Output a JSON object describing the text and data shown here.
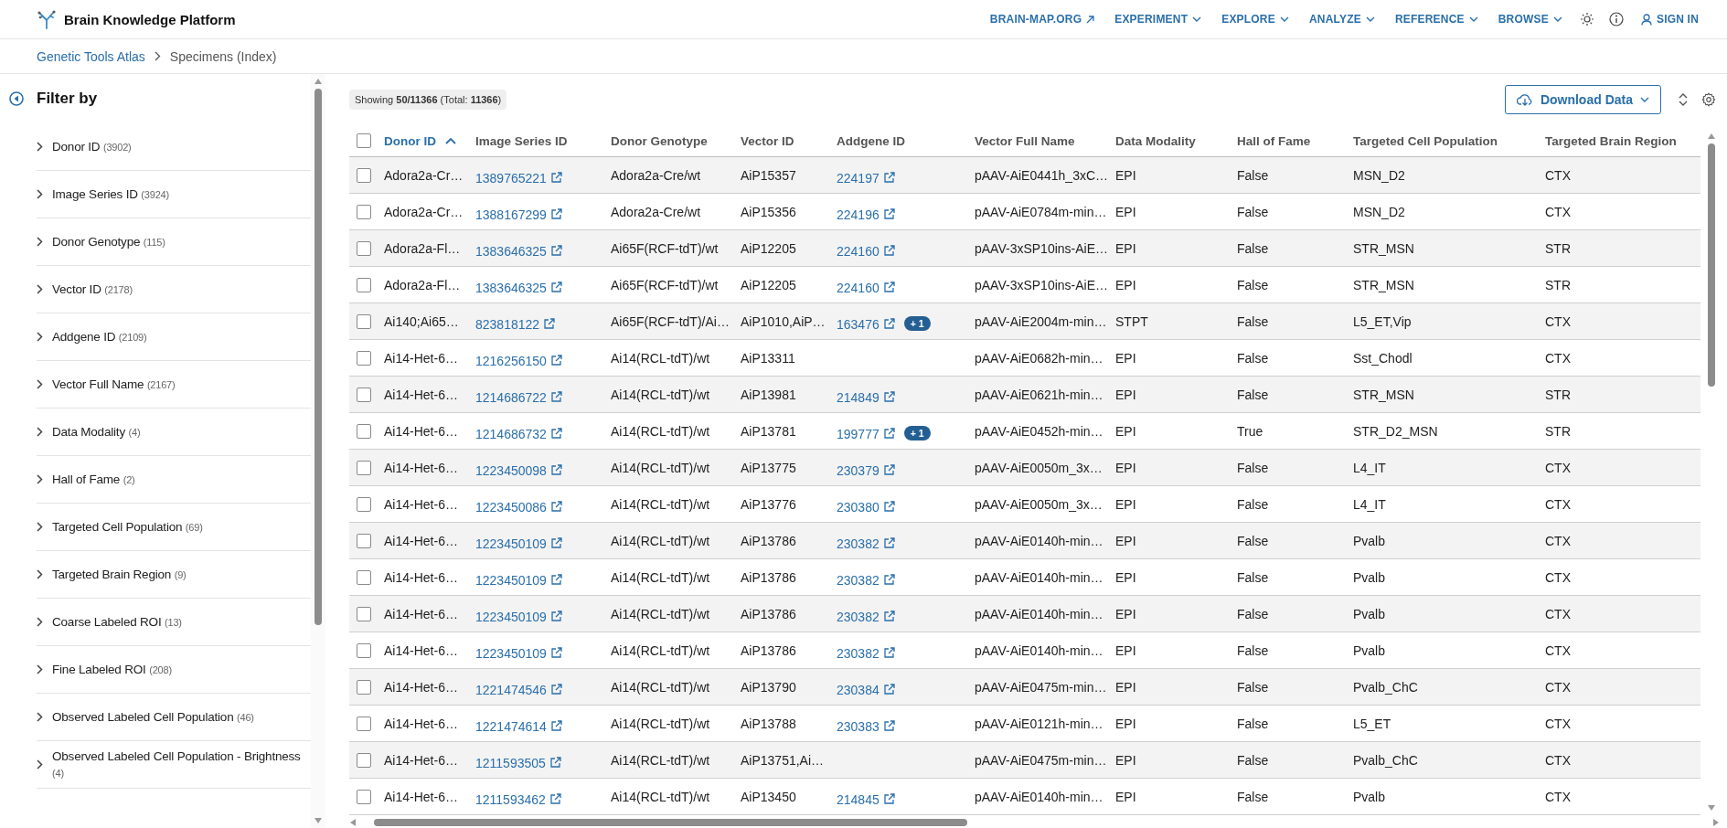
{
  "header": {
    "title": "Brain Knowledge Platform",
    "nav": [
      {
        "label": "BRAIN-MAP.ORG",
        "kind": "external"
      },
      {
        "label": "EXPERIMENT",
        "kind": "menu"
      },
      {
        "label": "EXPLORE",
        "kind": "menu"
      },
      {
        "label": "ANALYZE",
        "kind": "menu"
      },
      {
        "label": "REFERENCE",
        "kind": "menu"
      },
      {
        "label": "BROWSE",
        "kind": "menu"
      }
    ],
    "sign_in": "SIGN IN"
  },
  "breadcrumb": [
    {
      "label": "Genetic Tools Atlas",
      "kind": "link"
    },
    {
      "label": "Specimens (Index)",
      "kind": "current"
    }
  ],
  "sidebar": {
    "title": "Filter by",
    "filters": [
      {
        "label": "Donor ID",
        "count": "(3902)",
        "expanded": false
      },
      {
        "label": "Image Series ID",
        "count": "(3924)",
        "expanded": false
      },
      {
        "label": "Donor Genotype",
        "count": "(115)",
        "expanded": false
      },
      {
        "label": "Vector ID",
        "count": "(2178)",
        "expanded": false
      },
      {
        "label": "Addgene ID",
        "count": "(2109)",
        "expanded": false
      },
      {
        "label": "Vector Full Name",
        "count": "(2167)",
        "expanded": false
      },
      {
        "label": "Data Modality",
        "count": "(4)",
        "expanded": false
      },
      {
        "label": "Hall of Fame",
        "count": "(2)",
        "expanded": false
      },
      {
        "label": "Targeted Cell Population",
        "count": "(69)",
        "expanded": false
      },
      {
        "label": "Targeted Brain Region",
        "count": "(9)",
        "expanded": false
      },
      {
        "label": "Coarse Labeled ROI",
        "count": "(13)",
        "expanded": false
      },
      {
        "label": "Fine Labeled ROI",
        "count": "(208)",
        "expanded": false
      },
      {
        "label": "Observed Labeled Cell Population",
        "count": "(46)",
        "expanded": false
      },
      {
        "label": "Observed Labeled Cell Population - Brightness",
        "count": "(4)",
        "expanded": false
      }
    ]
  },
  "table": {
    "summary": "Showing **50/11366** (Total: **11366**)",
    "download_button": "Download Data",
    "all_selected": false,
    "columns": [
      {
        "label": "Donor ID",
        "kind": "text",
        "sorted": true
      },
      {
        "label": "Image Series ID",
        "kind": "link",
        "sorted": false
      },
      {
        "label": "Donor Genotype",
        "kind": "text",
        "sorted": false
      },
      {
        "label": "Vector ID",
        "kind": "text",
        "sorted": false
      },
      {
        "label": "Addgene ID",
        "kind": "link",
        "sorted": false
      },
      {
        "label": "Vector Full Name",
        "kind": "text",
        "sorted": false
      },
      {
        "label": "Data Modality",
        "kind": "text",
        "sorted": false
      },
      {
        "label": "Hall of Fame",
        "kind": "text",
        "sorted": false
      },
      {
        "label": "Targeted Cell Population",
        "kind": "text",
        "sorted": false
      },
      {
        "label": "Targeted Brain Region",
        "kind": "text",
        "sorted": false
      }
    ],
    "rows": [
      {
        "selected": false,
        "cells": [
          "Adora2a-Cr…",
          "1389765221",
          "Adora2a-Cre/wt",
          "AiP15357",
          "224197",
          "pAAV-AiE0441h_3xC…",
          "EPI",
          "False",
          "MSN_D2",
          "CTX"
        ]
      },
      {
        "selected": false,
        "cells": [
          "Adora2a-Cr…",
          "1388167299",
          "Adora2a-Cre/wt",
          "AiP15356",
          "224196",
          "pAAV-AiE0784m-min…",
          "EPI",
          "False",
          "MSN_D2",
          "CTX"
        ]
      },
      {
        "selected": false,
        "cells": [
          "Adora2a-Fl…",
          "1383646325",
          "Ai65F(RCF-tdT)/wt",
          "AiP12205",
          "224160",
          "pAAV-3xSP10ins-AiE…",
          "EPI",
          "False",
          "STR_MSN",
          "STR"
        ]
      },
      {
        "selected": false,
        "cells": [
          "Adora2a-Fl…",
          "1383646325",
          "Ai65F(RCF-tdT)/wt",
          "AiP12205",
          "224160",
          "pAAV-3xSP10ins-AiE…",
          "EPI",
          "False",
          "STR_MSN",
          "STR"
        ]
      },
      {
        "selected": false,
        "cells": [
          "Ai140;Ai65…",
          "823818122",
          "Ai65F(RCF-tdT)/Ai…",
          "AiP1010,AiP…",
          {
            "text": "163476",
            "badge": "+ 1"
          },
          "pAAV-AiE2004m-min…",
          "STPT",
          "False",
          "L5_ET,Vip",
          "CTX"
        ]
      },
      {
        "selected": false,
        "cells": [
          "Ai14-Het-6…",
          "1216256150",
          "Ai14(RCL-tdT)/wt",
          "AiP13311",
          null,
          "pAAV-AiE0682h-min…",
          "EPI",
          "False",
          "Sst_Chodl",
          "CTX"
        ]
      },
      {
        "selected": false,
        "cells": [
          "Ai14-Het-6…",
          "1214686722",
          "Ai14(RCL-tdT)/wt",
          "AiP13981",
          "214849",
          "pAAV-AiE0621h-min…",
          "EPI",
          "False",
          "STR_MSN",
          "STR"
        ]
      },
      {
        "selected": false,
        "cells": [
          "Ai14-Het-6…",
          "1214686732",
          "Ai14(RCL-tdT)/wt",
          "AiP13781",
          {
            "text": "199777",
            "badge": "+ 1"
          },
          "pAAV-AiE0452h-min…",
          "EPI",
          "True",
          "STR_D2_MSN",
          "STR"
        ]
      },
      {
        "selected": false,
        "cells": [
          "Ai14-Het-6…",
          "1223450098",
          "Ai14(RCL-tdT)/wt",
          "AiP13775",
          "230379",
          "pAAV-AiE0050m_3x…",
          "EPI",
          "False",
          "L4_IT",
          "CTX"
        ]
      },
      {
        "selected": false,
        "cells": [
          "Ai14-Het-6…",
          "1223450086",
          "Ai14(RCL-tdT)/wt",
          "AiP13776",
          "230380",
          "pAAV-AiE0050m_3x…",
          "EPI",
          "False",
          "L4_IT",
          "CTX"
        ]
      },
      {
        "selected": false,
        "cells": [
          "Ai14-Het-6…",
          "1223450109",
          "Ai14(RCL-tdT)/wt",
          "AiP13786",
          "230382",
          "pAAV-AiE0140h-min…",
          "EPI",
          "False",
          "Pvalb",
          "CTX"
        ]
      },
      {
        "selected": false,
        "cells": [
          "Ai14-Het-6…",
          "1223450109",
          "Ai14(RCL-tdT)/wt",
          "AiP13786",
          "230382",
          "pAAV-AiE0140h-min…",
          "EPI",
          "False",
          "Pvalb",
          "CTX"
        ]
      },
      {
        "selected": false,
        "cells": [
          "Ai14-Het-6…",
          "1223450109",
          "Ai14(RCL-tdT)/wt",
          "AiP13786",
          "230382",
          "pAAV-AiE0140h-min…",
          "EPI",
          "False",
          "Pvalb",
          "CTX"
        ]
      },
      {
        "selected": false,
        "cells": [
          "Ai14-Het-6…",
          "1223450109",
          "Ai14(RCL-tdT)/wt",
          "AiP13786",
          "230382",
          "pAAV-AiE0140h-min…",
          "EPI",
          "False",
          "Pvalb",
          "CTX"
        ]
      },
      {
        "selected": false,
        "cells": [
          "Ai14-Het-6…",
          "1221474546",
          "Ai14(RCL-tdT)/wt",
          "AiP13790",
          "230384",
          "pAAV-AiE0475m-min…",
          "EPI",
          "False",
          "Pvalb_ChC",
          "CTX"
        ]
      },
      {
        "selected": false,
        "cells": [
          "Ai14-Het-6…",
          "1221474614",
          "Ai14(RCL-tdT)/wt",
          "AiP13788",
          "230383",
          "pAAV-AiE0121h-min…",
          "EPI",
          "False",
          "L5_ET",
          "CTX"
        ]
      },
      {
        "selected": false,
        "cells": [
          "Ai14-Het-6…",
          "1211593505",
          "Ai14(RCL-tdT)/wt",
          "AiP13751,Ai…",
          null,
          "pAAV-AiE0475m-min…",
          "EPI",
          "False",
          "Pvalb_ChC",
          "CTX"
        ]
      },
      {
        "selected": false,
        "cells": [
          "Ai14-Het-6…",
          "1211593462",
          "Ai14(RCL-tdT)/wt",
          "AiP13450",
          "214845",
          "pAAV-AiE0140h-min…",
          "EPI",
          "False",
          "Pvalb",
          "CTX"
        ]
      }
    ]
  }
}
